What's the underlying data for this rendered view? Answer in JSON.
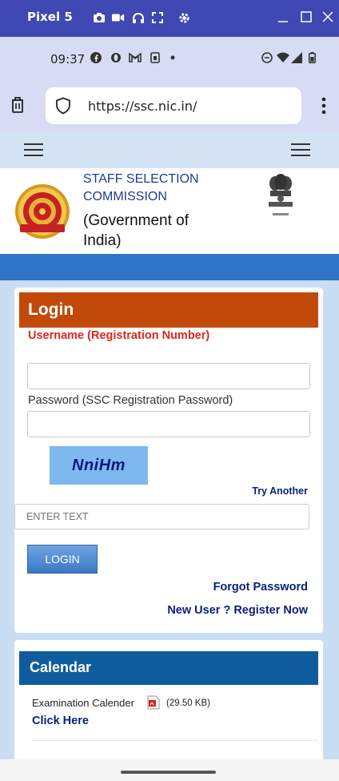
{
  "emulator": {
    "title": "Pixel 5",
    "tools": [
      "camera-icon",
      "video-icon",
      "headset-icon",
      "fullscreen-icon",
      "settings-icon"
    ],
    "window_controls": [
      "minimize-icon",
      "maximize-icon",
      "close-icon"
    ]
  },
  "status_bar": {
    "time": "09:37",
    "icons": [
      "facebook-icon",
      "opera-icon",
      "gmail-icon",
      "sim-icon",
      "dot-icon",
      "dnd-icon",
      "wifi-icon",
      "signal-icon",
      "battery-icon"
    ]
  },
  "browser": {
    "url": "https://ssc.nic.in/"
  },
  "site_header": {
    "org_line1": "STAFF SELECTION",
    "org_line2": "COMMISSION",
    "gov_text": "(Government of India)"
  },
  "login": {
    "title": "Login",
    "username_label": "Username (Registration Number)",
    "username_value": "",
    "password_label": "Password (SSC Registration Password)",
    "password_value": "",
    "captcha_text": "NniHm",
    "try_another": "Try Another",
    "captcha_placeholder": "ENTER TEXT",
    "button": "LOGIN",
    "forgot": "Forgot Password",
    "register": "New User ? Register Now"
  },
  "calendar": {
    "title": "Calendar",
    "item_label": "Examination Calender",
    "item_size": "(29.50 KB)",
    "link": "Click Here"
  },
  "colors": {
    "emulator_bar": "#3f48b3",
    "login_header": "#c14a0a",
    "calendar_header": "#0f5c9d",
    "link": "#0a1f7a",
    "error_red": "#e0271d"
  }
}
